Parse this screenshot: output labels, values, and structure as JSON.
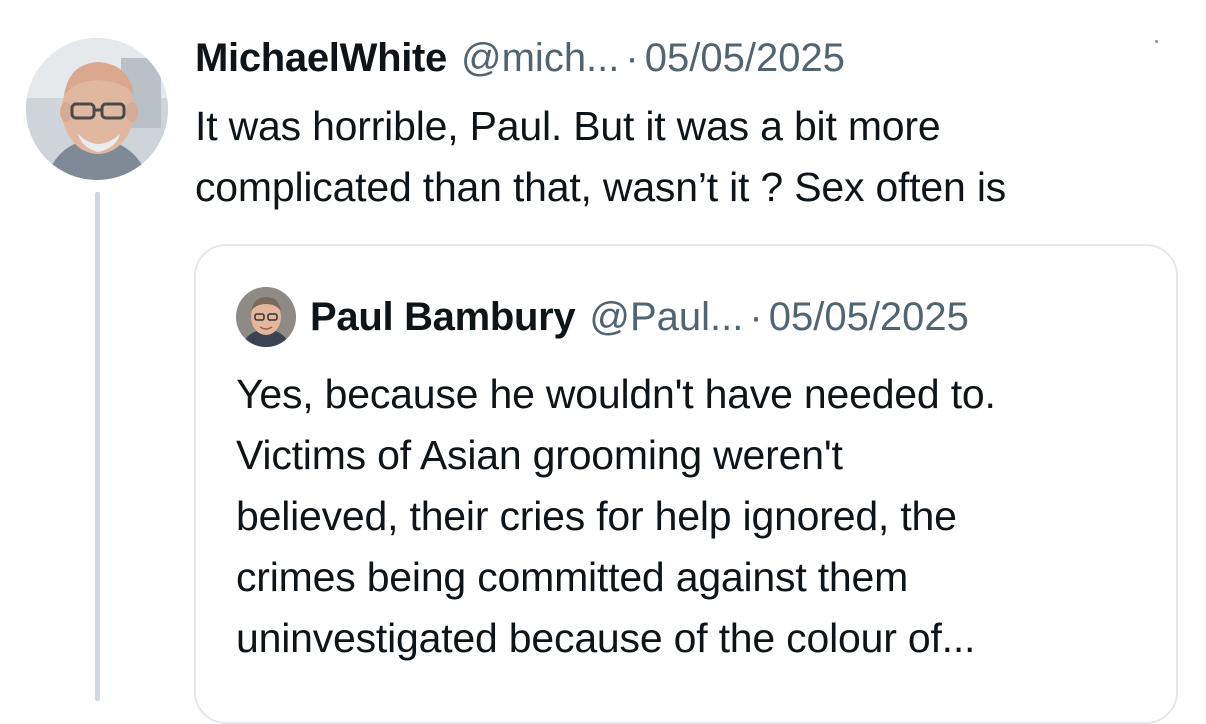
{
  "tweet": {
    "author_name": "MichaelWhite",
    "handle": "@mich...",
    "separator": "·",
    "date": "05/05/2025",
    "text": "It was horrible, Paul. But it was a bit more\ncomplicated than that, wasn’t it ? Sex often is"
  },
  "quote": {
    "author_name": "Paul Bambury",
    "handle": "@Paul...",
    "separator": "·",
    "date": "05/05/2025",
    "text": "Yes, because he wouldn't have needed to.\nVictims of Asian grooming weren't\nbelieved, their cries for help ignored, the\ncrimes being committed against them\nuninvestigated because of the colour of..."
  },
  "colors": {
    "text_primary": "#0f1419",
    "text_secondary": "#536471",
    "border": "#e3e8ec",
    "thread_line": "#cfd9de"
  },
  "icons": {
    "main_avatar": "avatar-photo",
    "quote_avatar": "avatar-photo"
  }
}
